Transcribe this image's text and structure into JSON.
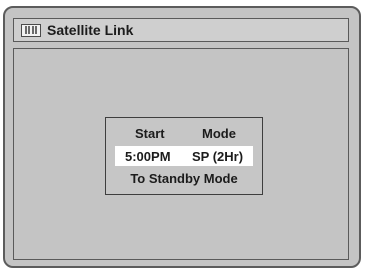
{
  "header": {
    "title": "Satellite Link",
    "icon": "menu-bars-icon"
  },
  "dialog": {
    "start_label": "Start",
    "mode_label": "Mode",
    "start_value": "5:00PM",
    "mode_value": "SP (2Hr)",
    "message": "To Standby Mode"
  },
  "colors": {
    "background": "#c4c4c4",
    "border": "#5c5c5c",
    "highlight": "#ffffff"
  }
}
